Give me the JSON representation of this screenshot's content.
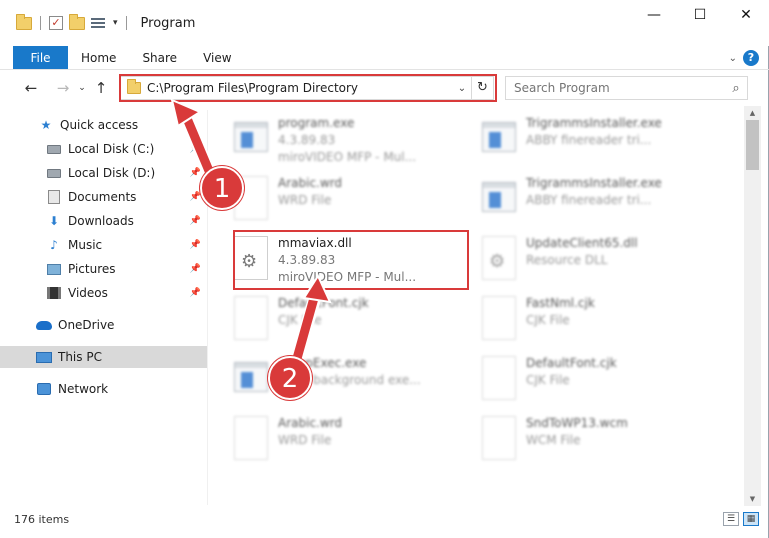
{
  "window": {
    "title": "Program",
    "controls": {
      "minimize": "—",
      "maximize": "☐",
      "close": "✕"
    }
  },
  "ribbon": {
    "file": "File",
    "tabs": [
      "Home",
      "Share",
      "View"
    ]
  },
  "nav": {
    "back": "←",
    "forward": "→",
    "recent": "⌄",
    "up": "↑",
    "address": "C:\\Program Files\\Program Directory",
    "refresh": "↻",
    "search_placeholder": "Search Program"
  },
  "sidebar": {
    "items": [
      {
        "label": "Quick access",
        "icon": "star-icon"
      },
      {
        "label": "Local Disk (C:)",
        "icon": "disk-icon",
        "pinned": true
      },
      {
        "label": "Local Disk (D:)",
        "icon": "disk-icon",
        "pinned": true
      },
      {
        "label": "Documents",
        "icon": "documents-icon",
        "pinned": true
      },
      {
        "label": "Downloads",
        "icon": "download-icon",
        "pinned": true
      },
      {
        "label": "Music",
        "icon": "music-icon",
        "pinned": true
      },
      {
        "label": "Pictures",
        "icon": "pictures-icon",
        "pinned": true
      },
      {
        "label": "Videos",
        "icon": "videos-icon",
        "pinned": true
      },
      {
        "label": "OneDrive",
        "icon": "onedrive-icon"
      },
      {
        "label": "This PC",
        "icon": "pc-icon",
        "selected": true
      },
      {
        "label": "Network",
        "icon": "network-icon"
      }
    ]
  },
  "files": [
    {
      "name": "program.exe",
      "line2": "4.3.89.83",
      "line3": "miroVIDEO MFP - Mul...",
      "kind": "exe"
    },
    {
      "name": "TrigrammsInstaller.exe",
      "line2": "ABBY finereader tri...",
      "kind": "exe"
    },
    {
      "name": "Arabic.wrd",
      "line2": "WRD File",
      "kind": "doc"
    },
    {
      "name": "TrigrammsInstaller.exe",
      "line2": "ABBY finereader tri...",
      "kind": "exe"
    },
    {
      "name": "mmaviax.dll",
      "line2": "4.3.89.83",
      "line3": "miroVIDEO MFP - Mul...",
      "kind": "dll"
    },
    {
      "name": "UpdateClient65.dll",
      "line2": "Resource DLL",
      "kind": "dll"
    },
    {
      "name": "DefaultFont.cjk",
      "line2": "CJK File",
      "kind": "doc"
    },
    {
      "name": "FastNml.cjk",
      "line2": "CJK File",
      "kind": "doc"
    },
    {
      "name": "SetupExec.exe",
      "line2": "ABBY background exe...",
      "kind": "exe"
    },
    {
      "name": "DefaultFont.cjk",
      "line2": "CJK File",
      "kind": "doc"
    },
    {
      "name": "Arabic.wrd",
      "line2": "WRD File",
      "kind": "doc"
    },
    {
      "name": "SndToWP13.wcm",
      "line2": "WCM File",
      "kind": "doc"
    }
  ],
  "annotations": {
    "step1": "1",
    "step2": "2",
    "color": "#d93a3a"
  },
  "status": {
    "count": "176 items"
  }
}
